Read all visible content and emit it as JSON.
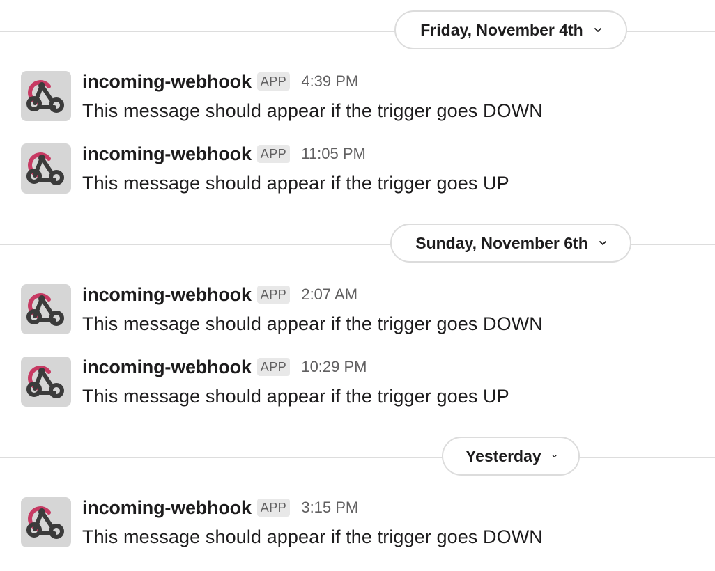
{
  "dividers": [
    {
      "label": "Friday, November 4th"
    },
    {
      "label": "Sunday, November 6th"
    },
    {
      "label": "Yesterday"
    }
  ],
  "messages": [
    {
      "author": "incoming-webhook",
      "badge": "APP",
      "time": "4:39 PM",
      "text": "This message should appear if the trigger goes DOWN"
    },
    {
      "author": "incoming-webhook",
      "badge": "APP",
      "time": "11:05 PM",
      "text": "This message should appear if the trigger goes UP"
    },
    {
      "author": "incoming-webhook",
      "badge": "APP",
      "time": "2:07 AM",
      "text": "This message should appear if the trigger goes DOWN"
    },
    {
      "author": "incoming-webhook",
      "badge": "APP",
      "time": "10:29 PM",
      "text": "This message should appear if the trigger goes UP"
    },
    {
      "author": "incoming-webhook",
      "badge": "APP",
      "time": "3:15 PM",
      "text": "This message should appear if the trigger goes DOWN"
    }
  ],
  "icons": {
    "avatar": "webhook-icon",
    "divider_chevron": "chevron-down-icon"
  },
  "colors": {
    "webhook_pink": "#c73a63",
    "webhook_dark": "#3b3b3b",
    "avatar_bg": "#d6d6d6",
    "badge_bg": "#e8e8e8",
    "muted_text": "#616061"
  }
}
